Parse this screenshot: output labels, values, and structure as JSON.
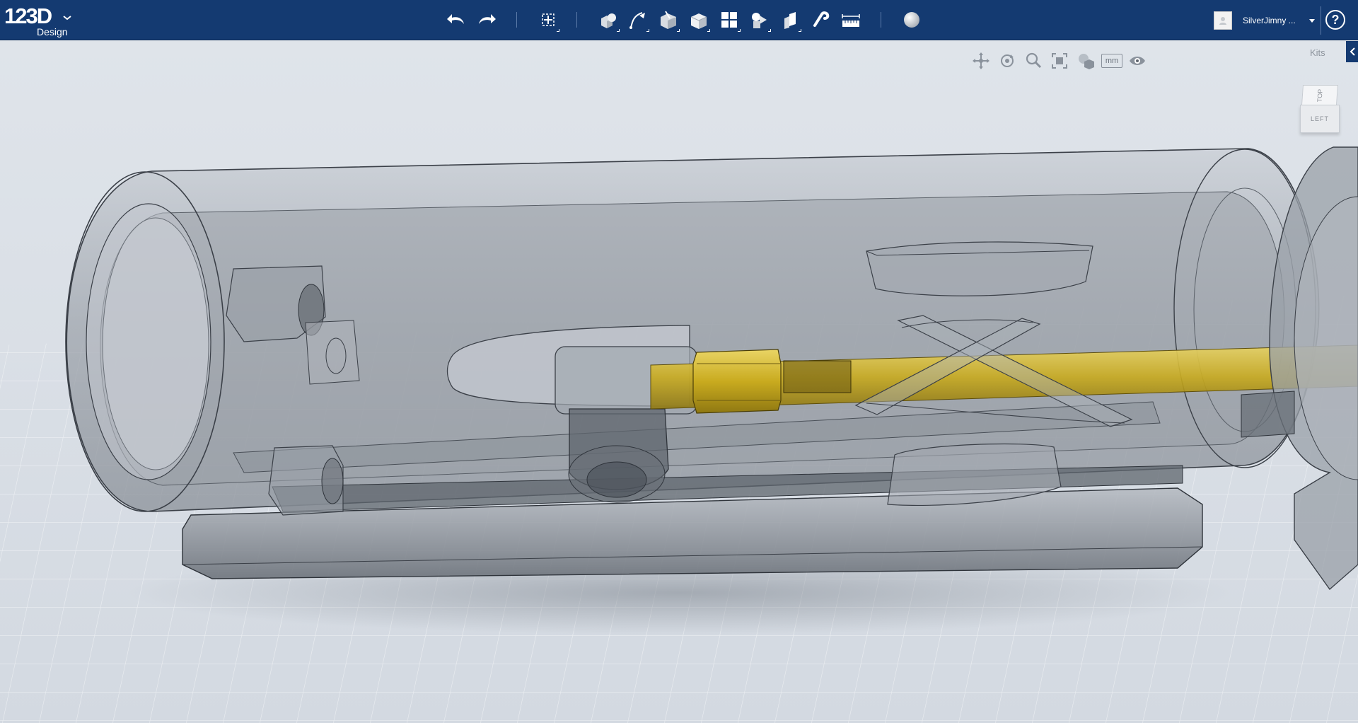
{
  "app": {
    "logo_text": "123D",
    "logo_sub": "Design"
  },
  "toolbar": {
    "buttons": [
      {
        "name": "undo-button",
        "icon": "undo-icon"
      },
      {
        "name": "redo-button",
        "icon": "redo-icon"
      },
      {
        "name": "transform-button",
        "icon": "transform-icon"
      },
      {
        "name": "primitives-button",
        "icon": "primitives-icon"
      },
      {
        "name": "sketch-button",
        "icon": "sketch-icon"
      },
      {
        "name": "construct-button",
        "icon": "construct-icon"
      },
      {
        "name": "modify-button",
        "icon": "modify-icon"
      },
      {
        "name": "pattern-button",
        "icon": "pattern-icon"
      },
      {
        "name": "grouping-button",
        "icon": "grouping-icon"
      },
      {
        "name": "combine-button",
        "icon": "combine-icon"
      },
      {
        "name": "snap-button",
        "icon": "snap-icon"
      },
      {
        "name": "measure-button",
        "icon": "measure-icon"
      },
      {
        "name": "material-button",
        "icon": "material-icon"
      }
    ]
  },
  "user": {
    "name": "SilverJimny ..."
  },
  "help": {
    "label": "?"
  },
  "navigation": {
    "units_label": "mm",
    "tools": [
      "pan-icon",
      "orbit-icon",
      "zoom-icon",
      "fit-icon",
      "material-view-icon",
      "visibility-icon"
    ]
  },
  "kits": {
    "label": "Kits"
  },
  "viewcube": {
    "top_label": "TOP",
    "front_label": "LEFT"
  },
  "colors": {
    "header": "#143a71",
    "viewport": "#dde2e8",
    "grid": "#ffffff",
    "rod": "#d4b728",
    "body_shell": "#8a9098"
  }
}
